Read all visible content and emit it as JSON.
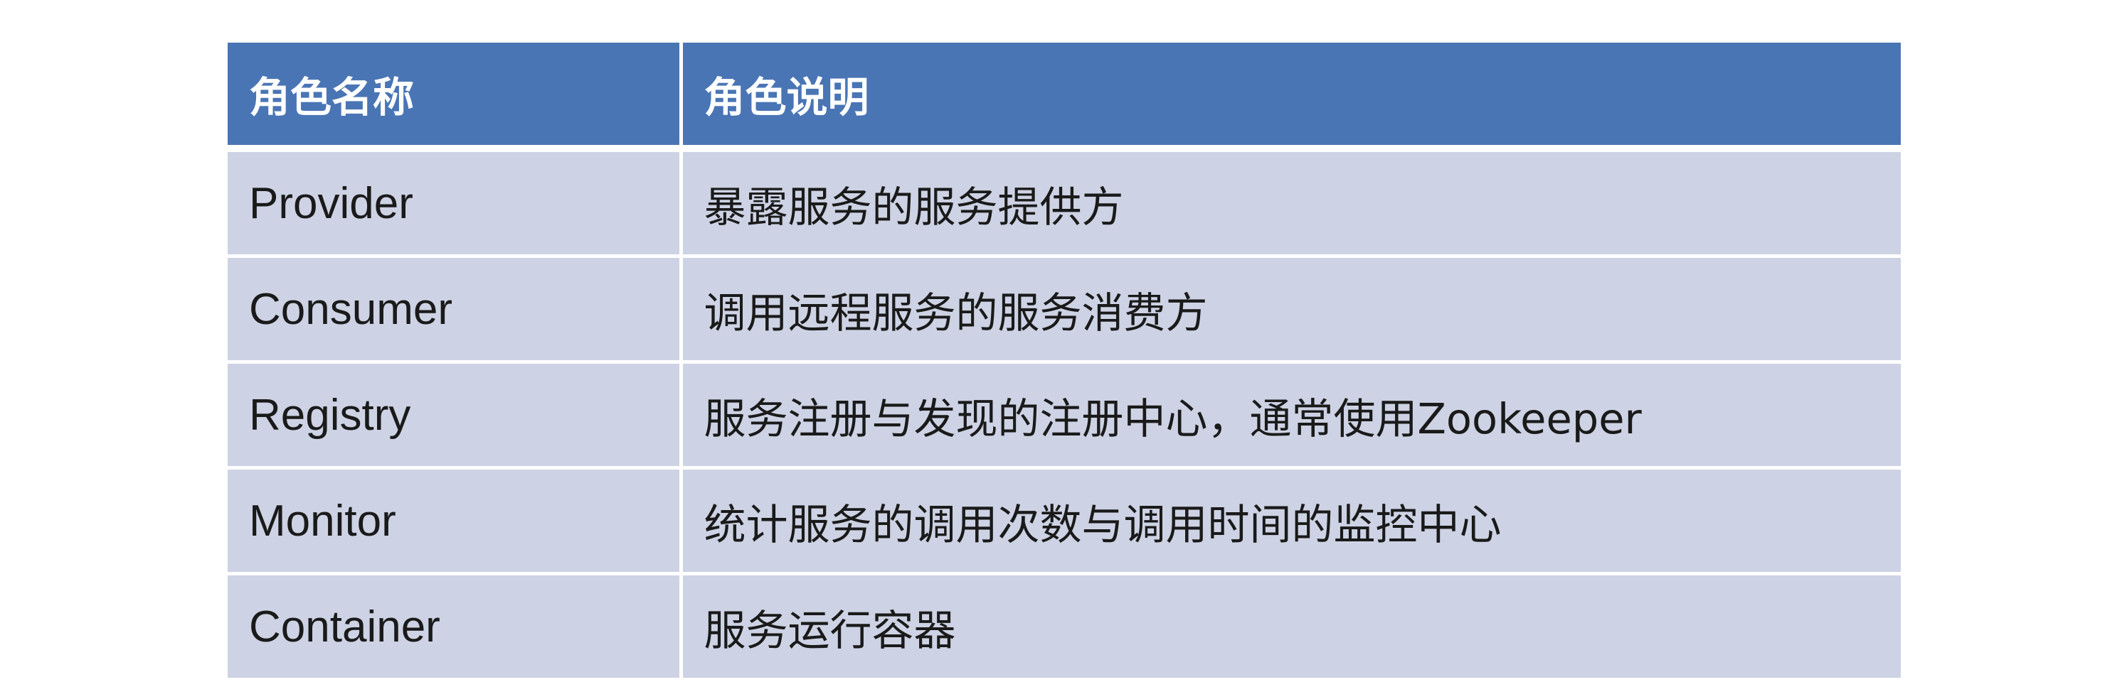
{
  "table": {
    "headers": [
      "角色名称",
      "角色说明"
    ],
    "rows": [
      {
        "name": "Provider",
        "description": "暴露服务的服务提供方"
      },
      {
        "name": "Consumer",
        "description": "调用远程服务的服务消费方"
      },
      {
        "name": "Registry",
        "description": "服务注册与发现的注册中心，通常使用Zookeeper"
      },
      {
        "name": "Monitor",
        "description": "统计服务的调用次数与调用时间的监控中心"
      },
      {
        "name": "Container",
        "description": "服务运行容器"
      }
    ]
  },
  "colors": {
    "header_bg": "#4a75b5",
    "row_bg": "#cdd3e4",
    "row_alt_bg": "#e8ebf3",
    "header_text": "#ffffff",
    "body_text": "#1a1a1a"
  }
}
